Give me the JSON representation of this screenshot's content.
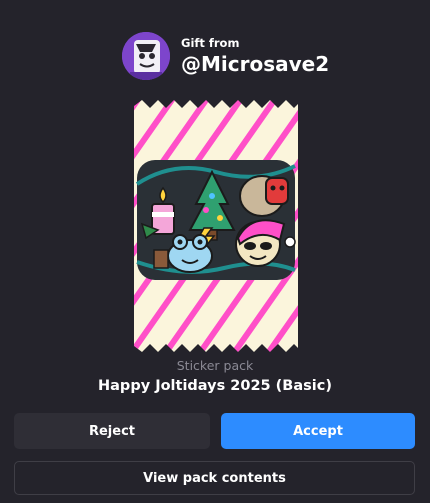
{
  "gift": {
    "from_label": "Gift from",
    "username": "@Microsave2"
  },
  "pack": {
    "type_label": "Sticker pack",
    "name": "Happy Joltidays 2025 (Basic)"
  },
  "actions": {
    "reject_label": "Reject",
    "accept_label": "Accept",
    "view_contents_label": "View pack contents"
  },
  "colors": {
    "background": "#24232b",
    "accent": "#2d8cff",
    "pack_wrapper": "#fbf5dc",
    "pack_stripe": "#ff4fc8"
  }
}
